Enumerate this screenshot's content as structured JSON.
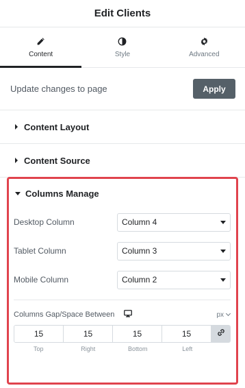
{
  "header": {
    "title": "Edit Clients"
  },
  "tabs": [
    {
      "label": "Content",
      "icon": "pencil-icon",
      "active": true
    },
    {
      "label": "Style",
      "icon": "half-circle-icon",
      "active": false
    },
    {
      "label": "Advanced",
      "icon": "gear-icon",
      "active": false
    }
  ],
  "update": {
    "text": "Update changes to page",
    "button_label": "Apply"
  },
  "sections": {
    "content_layout": "Content Layout",
    "content_source": "Content Source",
    "columns_manage": "Columns Manage"
  },
  "columns": {
    "desktop": {
      "label": "Desktop Column",
      "value": "Column 4"
    },
    "tablet": {
      "label": "Tablet Column",
      "value": "Column 3"
    },
    "mobile": {
      "label": "Mobile Column",
      "value": "Column 2"
    }
  },
  "gap": {
    "label": "Columns Gap/Space Between",
    "device_icon": "desktop-icon",
    "unit": "px",
    "values": {
      "top": "15",
      "right": "15",
      "bottom": "15",
      "left": "15"
    },
    "labels": {
      "top": "Top",
      "right": "Right",
      "bottom": "Bottom",
      "left": "Left"
    },
    "link_icon": "link-icon"
  },
  "colors": {
    "highlight": "#e0434d",
    "apply_button": "#556068"
  }
}
